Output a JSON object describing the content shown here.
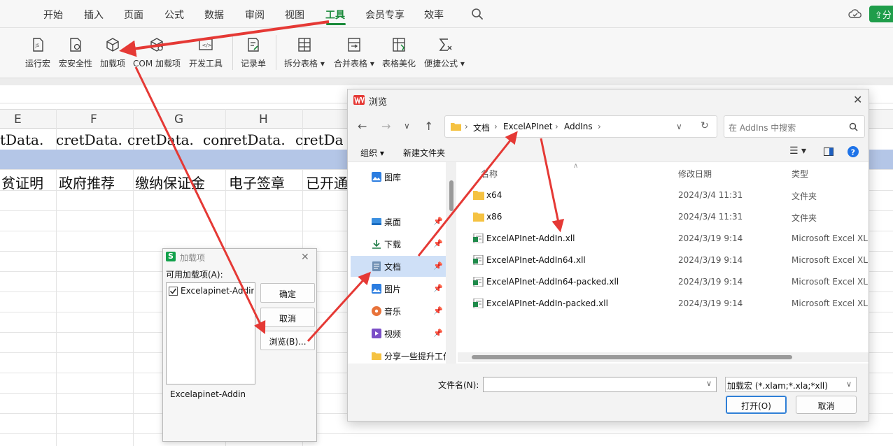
{
  "menu": {
    "tabs": [
      "开始",
      "插入",
      "页面",
      "公式",
      "数据",
      "审阅",
      "视图",
      "工具",
      "会员专享",
      "效率"
    ],
    "active_index": 7,
    "share_label": "分"
  },
  "ribbon": {
    "items": [
      {
        "label": "运行宏",
        "icon": "run-macro-icon"
      },
      {
        "label": "宏安全性",
        "icon": "macro-security-icon"
      },
      {
        "label": "加载项",
        "icon": "addins-cube-icon"
      },
      {
        "label": "COM 加载项",
        "icon": "com-addins-icon"
      },
      {
        "label": "开发工具",
        "icon": "developer-tools-icon"
      },
      {
        "label": "记录单",
        "icon": "record-form-icon"
      },
      {
        "label": "拆分表格",
        "icon": "split-table-icon",
        "dropdown": true
      },
      {
        "label": "合并表格",
        "icon": "merge-table-icon",
        "dropdown": true
      },
      {
        "label": "表格美化",
        "icon": "table-beautify-icon"
      },
      {
        "label": "便捷公式",
        "icon": "quick-formula-icon",
        "dropdown": true
      }
    ]
  },
  "sheet": {
    "columns": [
      "E",
      "F",
      "G",
      "H"
    ],
    "row1": [
      "tData.",
      "cretData.",
      "cretData.",
      "con",
      "retData.",
      "cretDa"
    ],
    "row3": [
      "贫证明",
      "政府推荐",
      "缴纳保证金",
      "电子签章",
      "已开通"
    ]
  },
  "addins_dialog": {
    "title": "加载项",
    "available_label": "可用加载项(A):",
    "item_label": "Excelapinet-Addin",
    "item_checked": true,
    "ok_label": "确定",
    "cancel_label": "取消",
    "browse_label": "浏览(B)...",
    "description": "Excelapinet-Addin"
  },
  "browse_dialog": {
    "title": "浏览",
    "path": [
      "文档",
      "ExcelAPInet",
      "AddIns"
    ],
    "search_placeholder": "在 AddIns 中搜索",
    "organize_label": "组织",
    "new_folder_label": "新建文件夹",
    "nav_items": [
      {
        "label": "图库",
        "icon": "gallery-icon",
        "pinned": false
      },
      {
        "label": "桌面",
        "icon": "desktop-icon",
        "pinned": true
      },
      {
        "label": "下载",
        "icon": "download-icon",
        "pinned": true
      },
      {
        "label": "文档",
        "icon": "documents-icon",
        "pinned": true,
        "selected": true
      },
      {
        "label": "图片",
        "icon": "pictures-icon",
        "pinned": true
      },
      {
        "label": "音乐",
        "icon": "music-icon",
        "pinned": true
      },
      {
        "label": "视频",
        "icon": "videos-icon",
        "pinned": true
      },
      {
        "label": "分享一些提升工作",
        "icon": "folder-icon",
        "pinned": false
      }
    ],
    "columns": {
      "name": "名称",
      "modified": "修改日期",
      "type": "类型"
    },
    "files": [
      {
        "name": "x64",
        "date": "2024/3/4 11:31",
        "type": "文件夹",
        "kind": "folder"
      },
      {
        "name": "x86",
        "date": "2024/3/4 11:31",
        "type": "文件夹",
        "kind": "folder"
      },
      {
        "name": "ExcelAPInet-AddIn.xll",
        "date": "2024/3/19 9:14",
        "type": "Microsoft Excel XLL",
        "kind": "xll"
      },
      {
        "name": "ExcelAPInet-AddIn64.xll",
        "date": "2024/3/19 9:14",
        "type": "Microsoft Excel XLL",
        "kind": "xll"
      },
      {
        "name": "ExcelAPInet-AddIn64-packed.xll",
        "date": "2024/3/19 9:14",
        "type": "Microsoft Excel XLL",
        "kind": "xll"
      },
      {
        "name": "ExcelAPInet-AddIn-packed.xll",
        "date": "2024/3/19 9:14",
        "type": "Microsoft Excel XLL",
        "kind": "xll"
      }
    ],
    "filename_label": "文件名(N):",
    "filename_value": "",
    "filter_label": "加载宏 (*.xlam;*.xla;*xll)",
    "open_label": "打开(O)",
    "cancel_label": "取消"
  },
  "colors": {
    "accent_green": "#1a8a3a",
    "arrow_red": "#e53935",
    "selected_row_blue": "#b4c6e7",
    "nav_selected": "#cfe0f7"
  }
}
